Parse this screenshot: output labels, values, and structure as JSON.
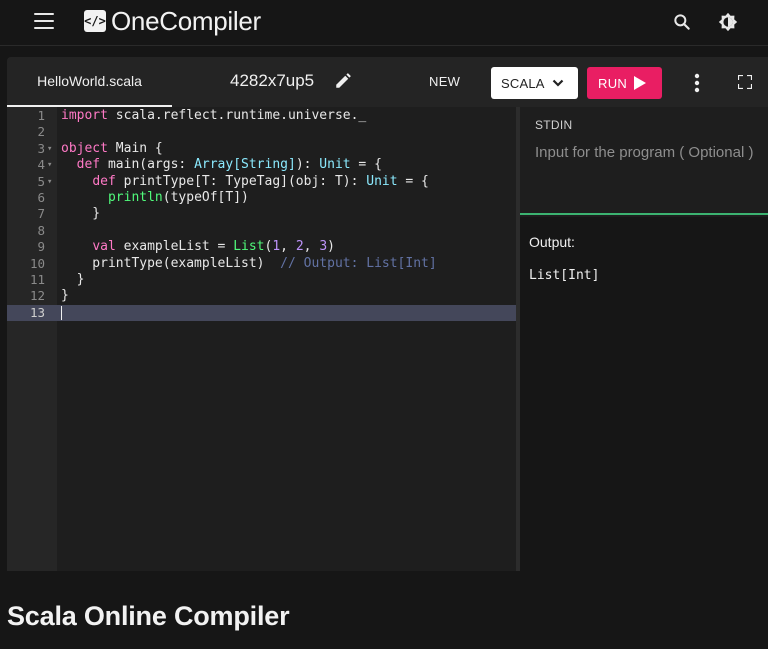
{
  "header": {
    "logo_mark": "</>",
    "logo_text": "OneCompiler"
  },
  "editor": {
    "file_tab": "HelloWorld.scala",
    "project_id": "4282x7up5",
    "new_label": "NEW",
    "language": "SCALA",
    "run_label": "RUN",
    "lines": [
      {
        "n": "1",
        "fold": false,
        "html": "<span class=\"kw\">import</span> scala.reflect.runtime.universe._"
      },
      {
        "n": "2",
        "fold": false,
        "html": ""
      },
      {
        "n": "3",
        "fold": true,
        "html": "<span class=\"kw\">object</span> Main {"
      },
      {
        "n": "4",
        "fold": true,
        "html": "  <span class=\"kw\">def</span> main(args: <span class=\"ty\">Array[String]</span>): <span class=\"ty\">Unit</span> = {"
      },
      {
        "n": "5",
        "fold": true,
        "html": "    <span class=\"kw\">def</span> printType[T: TypeTag](obj: T): <span class=\"ty\">Unit</span> = {"
      },
      {
        "n": "6",
        "fold": false,
        "html": "      <span class=\"fn\">println</span>(typeOf[T])"
      },
      {
        "n": "7",
        "fold": false,
        "html": "    }"
      },
      {
        "n": "8",
        "fold": false,
        "html": ""
      },
      {
        "n": "9",
        "fold": false,
        "html": "    <span class=\"kw\">val</span> exampleList = <span class=\"fn\">List</span>(<span class=\"num\">1</span>, <span class=\"num\">2</span>, <span class=\"num\">3</span>)"
      },
      {
        "n": "10",
        "fold": false,
        "html": "    printType(exampleList)  <span class=\"cm\">// Output: List[Int]</span>"
      },
      {
        "n": "11",
        "fold": false,
        "html": "  }"
      },
      {
        "n": "12",
        "fold": false,
        "html": "}"
      },
      {
        "n": "13",
        "fold": false,
        "html": "",
        "active": true
      }
    ]
  },
  "stdin": {
    "label": "STDIN",
    "placeholder": "Input for the program ( Optional )"
  },
  "output": {
    "label": "Output:",
    "text": "List[Int]"
  },
  "page": {
    "heading": "Scala Online Compiler"
  },
  "colors": {
    "run_button": "#e91e63",
    "stdin_border": "#3cb371",
    "active_line": "#44475a"
  }
}
